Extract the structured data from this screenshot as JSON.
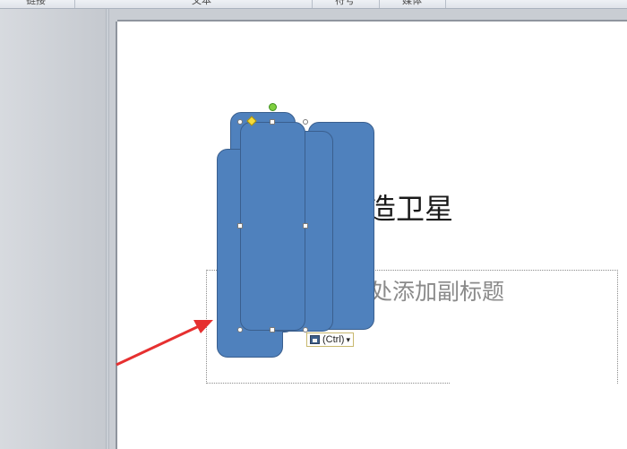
{
  "ribbon": {
    "groups": [
      "链接",
      "文本",
      "符号",
      "媒体"
    ]
  },
  "slide": {
    "title_visible": "造卫星",
    "subtitle_placeholder_visible": "处添加副标题"
  },
  "paste_options": {
    "label": "(Ctrl)",
    "dropdown_glyph": "▾",
    "icon": "paste-options-icon"
  },
  "annotation": {
    "arrow_color": "#e63030"
  },
  "colors": {
    "shape_fill": "#4f81bd",
    "shape_border": "#3a5f8e"
  }
}
